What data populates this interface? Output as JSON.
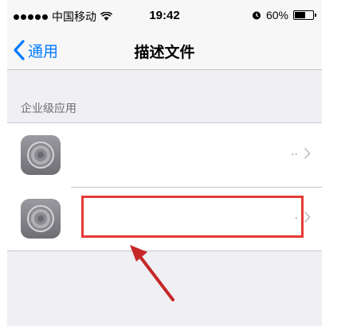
{
  "status_bar": {
    "carrier": "中国移动",
    "time": "19:42",
    "battery": "60%",
    "battery_level": 0.6,
    "icons": [
      "signal-dots-icon",
      "wifi-icon",
      "alarm-icon",
      "battery-icon"
    ]
  },
  "nav": {
    "back_label": "通用",
    "title": "描述文件"
  },
  "section": {
    "header": "企业级应用",
    "items": [
      {
        "label": "",
        "icon": "settings-gear-icon",
        "ellipsis": ".."
      },
      {
        "label": "",
        "icon": "settings-gear-icon",
        "ellipsis": "."
      }
    ]
  },
  "annotation": {
    "highlight_color": "#e53935"
  },
  "colors": {
    "accent": "#007aff",
    "background": "#efeff4",
    "bar": "#f7f7f7"
  }
}
